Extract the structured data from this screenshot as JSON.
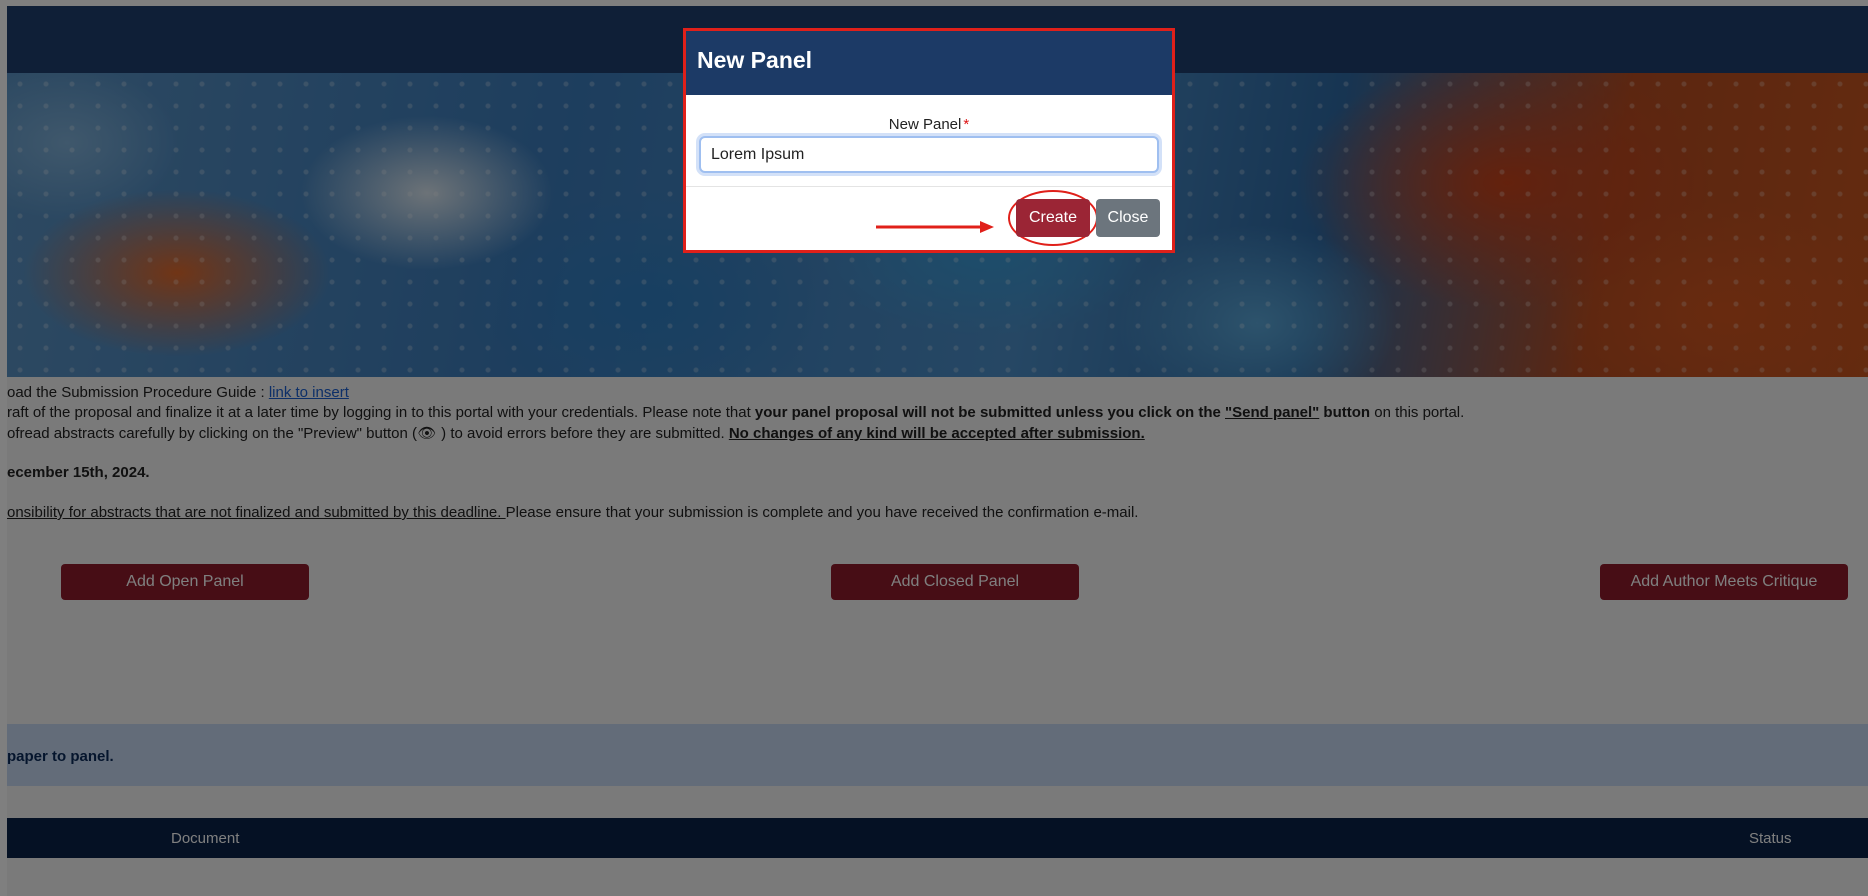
{
  "page": {
    "guide_prefix": "oad the Submission Procedure Guide : ",
    "guide_link": "link to insert",
    "draft_text_1": "raft of the proposal and finalize it at a later time by logging in to this portal with your credentials. Please note that ",
    "draft_bold_1": "your panel proposal will not be submitted unless you click on the ",
    "draft_bold_link": "\"Send panel\"",
    "draft_bold_2": " button",
    "draft_text_2": " on this portal.",
    "proof_text_1": "ofread abstracts carefully by clicking on the \"Preview\" button (",
    "proof_text_2": " ) to avoid errors before they are submitted. ",
    "proof_bold": "No changes of any kind will be accepted after submission.",
    "deadline": "ecember 15th, 2024.",
    "resp_underlined": "onsibility for abstracts that are not finalized and submitted by this deadline. ",
    "resp_text": "Please ensure that your submission is complete and you have received the confirmation e-mail.",
    "buttons": {
      "open_panel": "Add Open Panel",
      "closed_panel": "Add Closed Panel",
      "author_meets": "Add Author Meets Critique"
    },
    "info_bar": "paper to panel.",
    "table": {
      "col_document": "Document",
      "col_status": "Status"
    }
  },
  "modal": {
    "title": "New Panel",
    "field_label": "New Panel",
    "required_mark": "*",
    "field_value": "Lorem Ipsum",
    "create_label": "Create",
    "close_label": "Close"
  },
  "colors": {
    "navbar": "#1f3f6e",
    "accent_red": "#8e1b2a",
    "highlight": "#e0201a",
    "close_gray": "#6c757d"
  }
}
